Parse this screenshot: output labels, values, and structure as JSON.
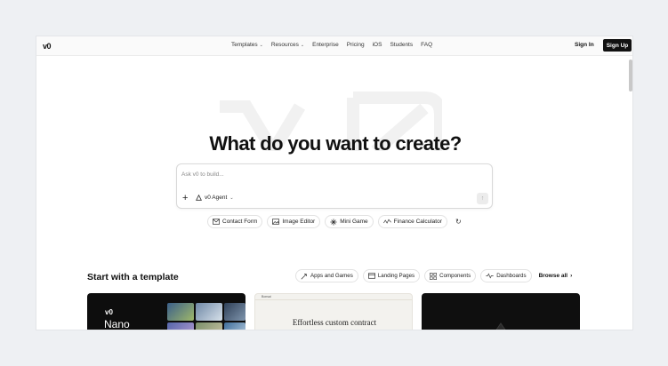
{
  "header": {
    "logo": "v0",
    "nav": [
      {
        "label": "Templates",
        "dropdown": true
      },
      {
        "label": "Resources",
        "dropdown": true
      },
      {
        "label": "Enterprise",
        "dropdown": false
      },
      {
        "label": "Pricing",
        "dropdown": false
      },
      {
        "label": "iOS",
        "dropdown": false
      },
      {
        "label": "Students",
        "dropdown": false
      },
      {
        "label": "FAQ",
        "dropdown": false
      }
    ],
    "sign_in": "Sign In",
    "sign_up": "Sign Up"
  },
  "hero": {
    "title": "What do you want to create?",
    "prompt": {
      "placeholder": "Ask v0 to build...",
      "value": "",
      "agent_label": "v0 Agent"
    },
    "suggestions": [
      {
        "label": "Contact Form",
        "icon": "mail-icon"
      },
      {
        "label": "Image Editor",
        "icon": "image-icon"
      },
      {
        "label": "Mini Game",
        "icon": "gamepad-icon"
      },
      {
        "label": "Finance Calculator",
        "icon": "chart-line-icon"
      }
    ]
  },
  "templates": {
    "title": "Start with a template",
    "filters": [
      {
        "label": "Apps and Games",
        "icon": "rocket-icon"
      },
      {
        "label": "Landing Pages",
        "icon": "browser-icon"
      },
      {
        "label": "Components",
        "icon": "grid-icon"
      },
      {
        "label": "Dashboards",
        "icon": "activity-icon"
      }
    ],
    "browse_all": "Browse all",
    "cards": [
      {
        "logo": "v0",
        "name": "Nano"
      },
      {
        "header_text": "Bonsai",
        "headline": "Effortless custom contract"
      },
      {}
    ]
  },
  "colors": {
    "page_bg": "#eef0f3",
    "surface": "#ffffff",
    "text": "#111111",
    "border": "#e2e2e2",
    "primary_button": "#111111"
  }
}
